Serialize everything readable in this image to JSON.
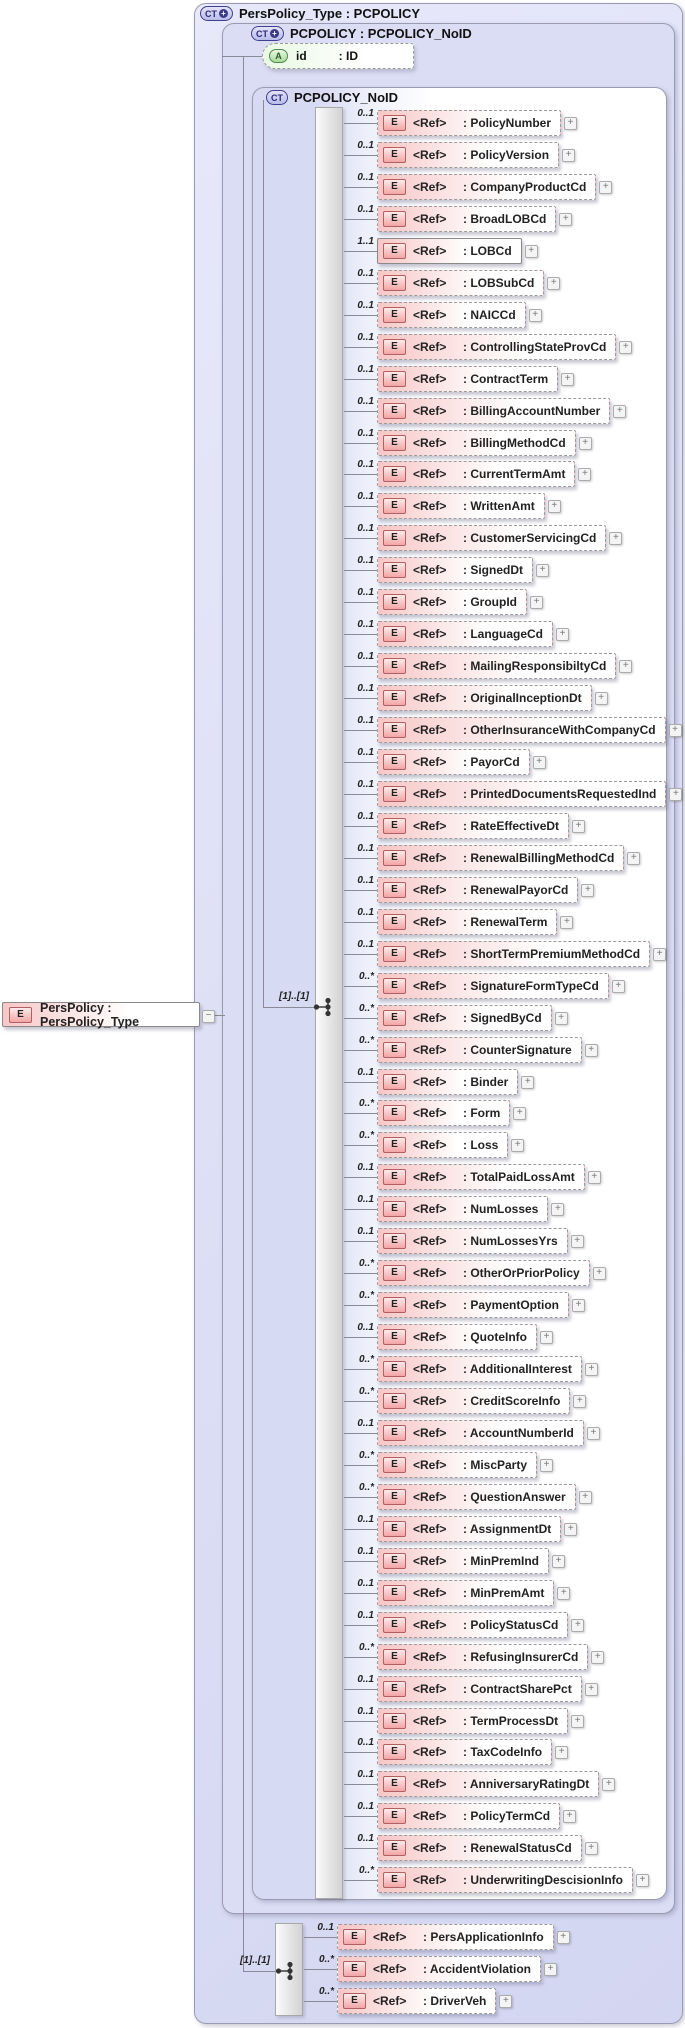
{
  "diagram": {
    "root": {
      "badge": "CT",
      "title": "PersPolicy_Type : PCPOLICY"
    },
    "pcpolicy": {
      "badge": "CT",
      "title": "PCPOLICY : PCPOLICY_NoID"
    },
    "attribute": {
      "badge": "A",
      "name": "id",
      "type": ": ID"
    },
    "noid": {
      "badge": "CT",
      "title": "PCPOLICY_NoID"
    },
    "left_element": {
      "badge": "E",
      "label": "PersPolicy : PersPolicy_Type",
      "collapse_glyph": "−"
    },
    "occurrence_label": "[1]..[1]",
    "ref_label": "<Ref>",
    "expand_glyph": "+",
    "badge_plus_glyph": "+",
    "colors": {
      "frame_fill": "#dbddf5",
      "element_pink": "#f7c6c6",
      "attribute_green": "#e9f9e2",
      "badge_navy": "#3f3f8f",
      "badge_red": "#b06060"
    },
    "main_rows": [
      {
        "name": "PolicyNumber",
        "card": "0..1"
      },
      {
        "name": "PolicyVersion",
        "card": "0..1"
      },
      {
        "name": "CompanyProductCd",
        "card": "0..1"
      },
      {
        "name": "BroadLOBCd",
        "card": "0..1"
      },
      {
        "name": "LOBCd",
        "card": "1..1"
      },
      {
        "name": "LOBSubCd",
        "card": "0..1"
      },
      {
        "name": "NAICCd",
        "card": "0..1"
      },
      {
        "name": "ControllingStateProvCd",
        "card": "0..1"
      },
      {
        "name": "ContractTerm",
        "card": "0..1"
      },
      {
        "name": "BillingAccountNumber",
        "card": "0..1"
      },
      {
        "name": "BillingMethodCd",
        "card": "0..1"
      },
      {
        "name": "CurrentTermAmt",
        "card": "0..1"
      },
      {
        "name": "WrittenAmt",
        "card": "0..1"
      },
      {
        "name": "CustomerServicingCd",
        "card": "0..1"
      },
      {
        "name": "SignedDt",
        "card": "0..1"
      },
      {
        "name": "GroupId",
        "card": "0..1"
      },
      {
        "name": "LanguageCd",
        "card": "0..1"
      },
      {
        "name": "MailingResponsibiltyCd",
        "card": "0..1"
      },
      {
        "name": "OriginalInceptionDt",
        "card": "0..1"
      },
      {
        "name": "OtherInsuranceWithCompanyCd",
        "card": "0..1"
      },
      {
        "name": "PayorCd",
        "card": "0..1"
      },
      {
        "name": "PrintedDocumentsRequestedInd",
        "card": "0..1"
      },
      {
        "name": "RateEffectiveDt",
        "card": "0..1"
      },
      {
        "name": "RenewalBillingMethodCd",
        "card": "0..1"
      },
      {
        "name": "RenewalPayorCd",
        "card": "0..1"
      },
      {
        "name": "RenewalTerm",
        "card": "0..1"
      },
      {
        "name": "ShortTermPremiumMethodCd",
        "card": "0..1"
      },
      {
        "name": "SignatureFormTypeCd",
        "card": "0..*"
      },
      {
        "name": "SignedByCd",
        "card": "0..*"
      },
      {
        "name": "CounterSignature",
        "card": "0..*"
      },
      {
        "name": "Binder",
        "card": "0..1"
      },
      {
        "name": "Form",
        "card": "0..*"
      },
      {
        "name": "Loss",
        "card": "0..*"
      },
      {
        "name": "TotalPaidLossAmt",
        "card": "0..1"
      },
      {
        "name": "NumLosses",
        "card": "0..1"
      },
      {
        "name": "NumLossesYrs",
        "card": "0..1"
      },
      {
        "name": "OtherOrPriorPolicy",
        "card": "0..*"
      },
      {
        "name": "PaymentOption",
        "card": "0..*"
      },
      {
        "name": "QuoteInfo",
        "card": "0..1"
      },
      {
        "name": "AdditionalInterest",
        "card": "0..*"
      },
      {
        "name": "CreditScoreInfo",
        "card": "0..*"
      },
      {
        "name": "AccountNumberId",
        "card": "0..1"
      },
      {
        "name": "MiscParty",
        "card": "0..*"
      },
      {
        "name": "QuestionAnswer",
        "card": "0..*"
      },
      {
        "name": "AssignmentDt",
        "card": "0..1"
      },
      {
        "name": "MinPremInd",
        "card": "0..1"
      },
      {
        "name": "MinPremAmt",
        "card": "0..1"
      },
      {
        "name": "PolicyStatusCd",
        "card": "0..1"
      },
      {
        "name": "RefusingInsurerCd",
        "card": "0..*"
      },
      {
        "name": "ContractSharePct",
        "card": "0..1"
      },
      {
        "name": "TermProcessDt",
        "card": "0..1"
      },
      {
        "name": "TaxCodeInfo",
        "card": "0..1"
      },
      {
        "name": "AnniversaryRatingDt",
        "card": "0..1"
      },
      {
        "name": "PolicyTermCd",
        "card": "0..1"
      },
      {
        "name": "RenewalStatusCd",
        "card": "0..1"
      },
      {
        "name": "UnderwritingDescisionInfo",
        "card": "0..*"
      }
    ],
    "bottom_rows": [
      {
        "name": "PersApplicationInfo",
        "card": "0..1"
      },
      {
        "name": "AccidentViolation",
        "card": "0..*"
      },
      {
        "name": "DriverVeh",
        "card": "0..*"
      }
    ]
  }
}
